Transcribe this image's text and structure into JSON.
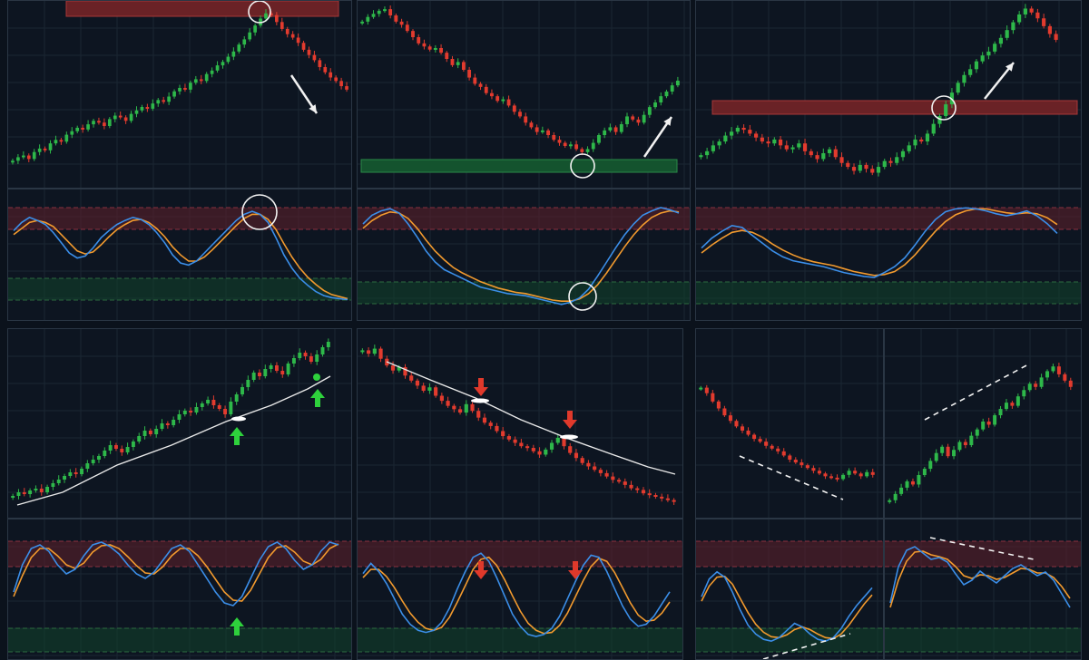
{
  "chart_data": [
    {
      "id": "top-left",
      "type": "candlestick",
      "pattern": "overbought-sell",
      "zone": "resistance",
      "arrow": "down",
      "marker": "circle",
      "closes": [
        12,
        14,
        15,
        13,
        17,
        19,
        18,
        22,
        24,
        23,
        27,
        29,
        31,
        30,
        33,
        35,
        34,
        32,
        36,
        38,
        37,
        35,
        39,
        41,
        43,
        42,
        45,
        47,
        46,
        49,
        52,
        54,
        53,
        57,
        59,
        58,
        62,
        64,
        67,
        69,
        72,
        75,
        79,
        82,
        86,
        90,
        94,
        97,
        96,
        92,
        88,
        85,
        83,
        80,
        76,
        73,
        70,
        66,
        63,
        60,
        58,
        55,
        53
      ]
    },
    {
      "id": "top-middle",
      "type": "candlestick",
      "pattern": "oversold-buy",
      "zone": "support",
      "arrow": "up",
      "marker": "circle",
      "closes": [
        88,
        91,
        93,
        95,
        96,
        92,
        88,
        86,
        82,
        78,
        74,
        72,
        70,
        71,
        68,
        64,
        60,
        62,
        57,
        52,
        48,
        46,
        42,
        40,
        37,
        38,
        34,
        30,
        27,
        23,
        20,
        17,
        18,
        15,
        12,
        10,
        8,
        9,
        6,
        4,
        6,
        10,
        15,
        18,
        20,
        17,
        22,
        27,
        25,
        23,
        28,
        33,
        36,
        40,
        43,
        47,
        50
      ]
    },
    {
      "id": "top-right",
      "type": "candlestick",
      "pattern": "resistance-breakout",
      "zone": "resistance",
      "arrow": "up",
      "marker": "circle",
      "closes": [
        20,
        22,
        25,
        27,
        30,
        32,
        34,
        33,
        31,
        29,
        27,
        26,
        28,
        25,
        23,
        24,
        26,
        22,
        20,
        18,
        21,
        23,
        19,
        16,
        14,
        12,
        15,
        13,
        11,
        14,
        17,
        16,
        19,
        22,
        25,
        28,
        27,
        31,
        36,
        40,
        46,
        52,
        57,
        61,
        64,
        68,
        71,
        73,
        77,
        80,
        84,
        88,
        92,
        95,
        93,
        90,
        86,
        82,
        79
      ]
    },
    {
      "id": "middle-left",
      "type": "candlestick",
      "pattern": "uptrend-ma-bounce",
      "arrow": "up",
      "closes": [
        10,
        12,
        11,
        13,
        14,
        12,
        15,
        17,
        19,
        21,
        23,
        22,
        25,
        28,
        30,
        32,
        35,
        38,
        36,
        34,
        37,
        40,
        43,
        46,
        44,
        47,
        50,
        49,
        52,
        55,
        57,
        56,
        59,
        61,
        63,
        60,
        58,
        55,
        62,
        66,
        70,
        74,
        78,
        76,
        80,
        82,
        79,
        77,
        83,
        86,
        89,
        87,
        84,
        88,
        92,
        95
      ]
    },
    {
      "id": "middle-center",
      "type": "candlestick",
      "pattern": "downtrend-ma-rejection",
      "arrow": "down",
      "closes": [
        95,
        93,
        96,
        90,
        86,
        83,
        85,
        80,
        77,
        74,
        71,
        73,
        68,
        65,
        62,
        60,
        58,
        63,
        59,
        55,
        52,
        50,
        47,
        44,
        42,
        40,
        38,
        37,
        35,
        33,
        36,
        40,
        43,
        38,
        34,
        31,
        28,
        26,
        24,
        22,
        20,
        18,
        17,
        15,
        13,
        12,
        10,
        9,
        8,
        7,
        6,
        5
      ]
    },
    {
      "id": "bottom-right-left",
      "type": "candlestick",
      "pattern": "bullish-divergence",
      "closes": [
        78,
        74,
        68,
        63,
        58,
        54,
        50,
        47,
        44,
        41,
        39,
        36,
        34,
        32,
        29,
        26,
        24,
        22,
        20,
        18,
        16,
        14,
        13,
        12,
        15,
        18,
        16,
        14,
        17,
        15
      ]
    },
    {
      "id": "bottom-right-right",
      "type": "candlestick",
      "pattern": "bearish-divergence",
      "closes": [
        10,
        14,
        18,
        22,
        20,
        26,
        30,
        35,
        40,
        44,
        38,
        42,
        47,
        45,
        51,
        55,
        60,
        58,
        64,
        68,
        72,
        70,
        76,
        80,
        84,
        82,
        88,
        92,
        95,
        90,
        86,
        82
      ]
    }
  ],
  "oscillators": [
    {
      "id": "top-left-osc",
      "marker": "circle",
      "k": [
        72,
        80,
        85,
        82,
        78,
        70,
        60,
        50,
        45,
        47,
        55,
        65,
        72,
        78,
        82,
        85,
        83,
        78,
        70,
        60,
        48,
        40,
        38,
        42,
        50,
        58,
        66,
        74,
        82,
        88,
        91,
        88,
        80,
        65,
        48,
        35,
        25,
        18,
        12,
        8,
        6,
        5,
        4
      ],
      "d": [
        68,
        74,
        80,
        82,
        80,
        76,
        68,
        60,
        52,
        49,
        51,
        58,
        66,
        73,
        78,
        82,
        83,
        80,
        74,
        66,
        56,
        48,
        42,
        42,
        46,
        53,
        61,
        69,
        77,
        84,
        88,
        88,
        83,
        73,
        59,
        46,
        35,
        26,
        19,
        13,
        9,
        7,
        5
      ]
    },
    {
      "id": "top-middle-osc",
      "marker": "circle",
      "k": [
        80,
        88,
        92,
        94,
        90,
        80,
        68,
        55,
        45,
        38,
        34,
        30,
        26,
        22,
        20,
        18,
        16,
        15,
        14,
        12,
        10,
        8,
        6,
        8,
        12,
        20,
        32,
        45,
        58,
        70,
        80,
        88,
        92,
        95,
        93,
        90
      ],
      "d": [
        76,
        83,
        88,
        91,
        90,
        85,
        76,
        65,
        55,
        47,
        40,
        35,
        31,
        27,
        24,
        21,
        19,
        17,
        16,
        14,
        12,
        10,
        9,
        9,
        11,
        16,
        24,
        35,
        47,
        59,
        70,
        79,
        86,
        90,
        92,
        91
      ]
    },
    {
      "id": "top-right-osc",
      "marker": "none",
      "k": [
        55,
        65,
        72,
        78,
        76,
        68,
        60,
        52,
        46,
        42,
        40,
        38,
        36,
        33,
        30,
        28,
        26,
        25,
        30,
        36,
        45,
        58,
        72,
        84,
        92,
        95,
        96,
        95,
        93,
        90,
        88,
        90,
        93,
        88,
        80,
        70
      ],
      "d": [
        50,
        58,
        65,
        71,
        73,
        71,
        66,
        59,
        53,
        48,
        44,
        41,
        39,
        37,
        34,
        31,
        29,
        27,
        28,
        31,
        38,
        48,
        60,
        72,
        82,
        89,
        93,
        95,
        95,
        93,
        91,
        90,
        91,
        90,
        86,
        79
      ]
    },
    {
      "id": "middle-left-osc",
      "marker": "up-arrow",
      "k": [
        40,
        70,
        88,
        92,
        85,
        70,
        60,
        65,
        80,
        92,
        95,
        90,
        82,
        70,
        60,
        55,
        62,
        75,
        88,
        92,
        85,
        70,
        55,
        40,
        28,
        25,
        35,
        55,
        75,
        90,
        95,
        88,
        75,
        65,
        70,
        85,
        95,
        92
      ],
      "d": [
        35,
        58,
        78,
        88,
        88,
        80,
        70,
        66,
        72,
        84,
        91,
        92,
        88,
        79,
        69,
        61,
        60,
        68,
        80,
        88,
        88,
        80,
        68,
        54,
        40,
        31,
        30,
        42,
        60,
        78,
        89,
        91,
        84,
        74,
        70,
        76,
        88,
        93
      ]
    },
    {
      "id": "middle-center-osc",
      "marker": "down-arrow",
      "k": [
        70,
        80,
        72,
        60,
        45,
        30,
        20,
        14,
        12,
        14,
        22,
        36,
        55,
        72,
        86,
        90,
        82,
        66,
        48,
        30,
        18,
        10,
        8,
        10,
        16,
        28,
        45,
        62,
        78,
        88,
        86,
        72,
        55,
        38,
        25,
        18,
        20,
        28,
        40,
        52
      ],
      "d": [
        66,
        74,
        74,
        67,
        56,
        43,
        31,
        22,
        16,
        14,
        17,
        27,
        42,
        58,
        74,
        84,
        86,
        78,
        64,
        48,
        33,
        21,
        14,
        11,
        12,
        19,
        31,
        47,
        63,
        77,
        85,
        82,
        71,
        56,
        41,
        29,
        23,
        24,
        31,
        42
      ]
    },
    {
      "id": "bottom-right-left-osc",
      "marker": "dashed-line",
      "k": [
        60,
        80,
        88,
        82,
        65,
        45,
        28,
        18,
        12,
        10,
        14,
        22,
        30,
        26,
        18,
        12,
        10,
        14,
        24,
        38,
        50,
        60,
        70
      ],
      "d": [
        55,
        72,
        82,
        83,
        74,
        58,
        42,
        29,
        20,
        15,
        14,
        17,
        23,
        26,
        23,
        18,
        14,
        13,
        18,
        28,
        40,
        52,
        62
      ]
    },
    {
      "id": "bottom-right-right-osc",
      "marker": "dashed-line",
      "k": [
        30,
        70,
        88,
        92,
        85,
        78,
        80,
        75,
        62,
        50,
        55,
        65,
        58,
        52,
        60,
        68,
        72,
        66,
        60,
        64,
        55,
        40,
        25
      ],
      "d": [
        25,
        55,
        76,
        86,
        87,
        83,
        81,
        78,
        70,
        60,
        57,
        61,
        60,
        56,
        58,
        63,
        68,
        67,
        63,
        63,
        58,
        48,
        35
      ]
    }
  ],
  "colors": {
    "background": "#0b121c",
    "panel_background": "#0d1521",
    "grid": "#1a2633",
    "candle_up": "#2eb84a",
    "candle_down": "#e23b2e",
    "k_line": "#3b8ee8",
    "d_line": "#f29a2e",
    "overbought_zone": "#5a1f2a",
    "oversold_zone": "#11402a",
    "resistance_zone": "#6a2226",
    "support_zone": "#14532e",
    "moving_average": "#e9e9e9",
    "annotation": "#f2f2f2",
    "arrow_green": "#2ed13c",
    "arrow_red": "#e0392b"
  }
}
